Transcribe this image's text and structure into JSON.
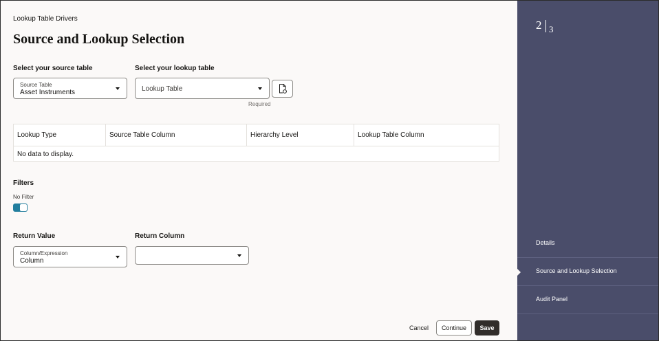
{
  "breadcrumb": "Lookup Table Drivers",
  "title": "Source and Lookup Selection",
  "source": {
    "heading": "Select your source table",
    "field_label": "Source Table",
    "value": "Asset Instruments"
  },
  "lookup": {
    "heading": "Select your lookup table",
    "placeholder": "Lookup Table",
    "required_text": "Required",
    "add_icon": "document-add-icon"
  },
  "table": {
    "columns": [
      "Lookup Type",
      "Source Table Column",
      "Hierarchy Level",
      "Lookup Table Column"
    ],
    "empty_text": "No data to display."
  },
  "filters": {
    "heading": "Filters",
    "toggle_label": "No Filter",
    "toggle_on": true
  },
  "return_value": {
    "heading": "Return Value",
    "field_label": "Column/Expression",
    "value": "Column"
  },
  "return_column": {
    "heading": "Return Column",
    "value": ""
  },
  "buttons": {
    "cancel": "Cancel",
    "continue": "Continue",
    "save": "Save"
  },
  "steps": {
    "current": "2",
    "total": "3",
    "items": [
      {
        "label": "Details",
        "active": false
      },
      {
        "label": "Source and Lookup Selection",
        "active": true
      },
      {
        "label": "Audit Panel",
        "active": false
      }
    ]
  },
  "colors": {
    "sidebar": "#4a4d6a",
    "toggle": "#227e9e",
    "primary_button": "#312d2a",
    "page_bg": "#fbf9f8"
  }
}
